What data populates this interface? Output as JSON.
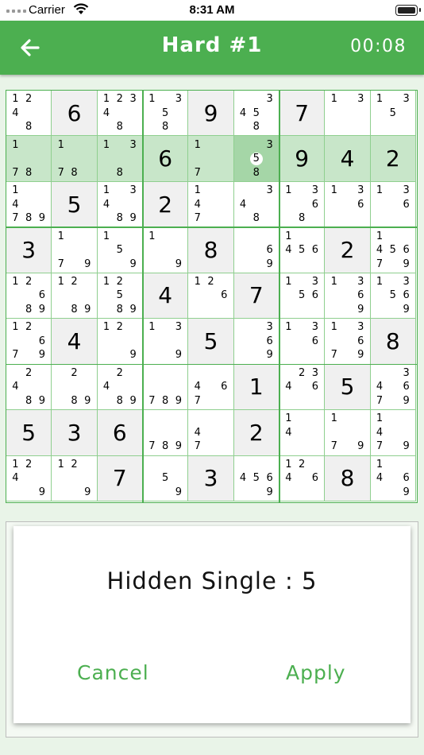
{
  "status": {
    "carrier": "Carrier",
    "time": "8:31 AM"
  },
  "header": {
    "title": "Hard #1",
    "timer": "00:08",
    "back_icon": "arrow-left-icon"
  },
  "colors": {
    "accent": "#4caf50",
    "given_bg": "#f0f0f0",
    "row_highlight": "#c8e6c9",
    "selected": "#a5d6a7"
  },
  "board": {
    "selected": [
      1,
      5
    ],
    "highlighted_row": 1,
    "hint_note": "5",
    "cells": [
      [
        {
          "notes": [
            1,
            2,
            4,
            8
          ]
        },
        {
          "value": 6,
          "given": true
        },
        {
          "notes": [
            1,
            2,
            3,
            4,
            8
          ]
        },
        {
          "notes": [
            1,
            3,
            5,
            8
          ]
        },
        {
          "value": 9,
          "given": true
        },
        {
          "notes": [
            3,
            4,
            5,
            8
          ]
        },
        {
          "value": 7,
          "given": true
        },
        {
          "notes": [
            1,
            3
          ]
        },
        {
          "notes": [
            1,
            3,
            5
          ]
        }
      ],
      [
        {
          "notes": [
            1,
            7,
            8
          ]
        },
        {
          "notes": [
            1,
            7,
            8
          ]
        },
        {
          "notes": [
            1,
            3,
            8
          ]
        },
        {
          "value": 6,
          "given": true
        },
        {
          "notes": [
            1,
            7
          ]
        },
        {
          "notes": [
            3,
            5,
            8
          ]
        },
        {
          "value": 9,
          "given": true
        },
        {
          "value": 4,
          "given": true
        },
        {
          "value": 2,
          "given": true
        }
      ],
      [
        {
          "notes": [
            1,
            4,
            7,
            8,
            9
          ]
        },
        {
          "value": 5,
          "given": true
        },
        {
          "notes": [
            1,
            3,
            4,
            8,
            9
          ]
        },
        {
          "value": 2,
          "given": true
        },
        {
          "notes": [
            1,
            4,
            7
          ]
        },
        {
          "notes": [
            3,
            4,
            8
          ]
        },
        {
          "notes": [
            1,
            3,
            6,
            8
          ]
        },
        {
          "notes": [
            1,
            3,
            6
          ]
        },
        {
          "notes": [
            1,
            3,
            6
          ]
        }
      ],
      [
        {
          "value": 3,
          "given": true
        },
        {
          "notes": [
            1,
            7,
            9
          ]
        },
        {
          "notes": [
            1,
            5,
            9
          ]
        },
        {
          "notes": [
            1,
            9
          ]
        },
        {
          "value": 8,
          "given": true
        },
        {
          "notes": [
            6,
            9
          ]
        },
        {
          "notes": [
            1,
            4,
            5,
            6
          ]
        },
        {
          "value": 2,
          "given": true
        },
        {
          "notes": [
            1,
            4,
            5,
            6,
            7,
            9
          ]
        }
      ],
      [
        {
          "notes": [
            1,
            2,
            6,
            8,
            9
          ]
        },
        {
          "notes": [
            1,
            2,
            8,
            9
          ]
        },
        {
          "notes": [
            1,
            2,
            5,
            8,
            9
          ]
        },
        {
          "value": 4,
          "given": true
        },
        {
          "notes": [
            1,
            2,
            6
          ]
        },
        {
          "value": 7,
          "given": true
        },
        {
          "notes": [
            1,
            3,
            5,
            6
          ]
        },
        {
          "notes": [
            1,
            3,
            6,
            9
          ]
        },
        {
          "notes": [
            1,
            3,
            5,
            6,
            9
          ]
        }
      ],
      [
        {
          "notes": [
            1,
            2,
            6,
            7,
            9
          ]
        },
        {
          "value": 4,
          "given": true
        },
        {
          "notes": [
            1,
            2,
            9
          ]
        },
        {
          "notes": [
            1,
            3,
            9
          ]
        },
        {
          "value": 5,
          "given": true
        },
        {
          "notes": [
            3,
            6,
            9
          ]
        },
        {
          "notes": [
            1,
            3,
            6
          ]
        },
        {
          "notes": [
            1,
            3,
            6,
            7,
            9
          ]
        },
        {
          "value": 8,
          "given": true
        }
      ],
      [
        {
          "notes": [
            2,
            4,
            8,
            9
          ]
        },
        {
          "notes": [
            2,
            8,
            9
          ]
        },
        {
          "notes": [
            2,
            4,
            8,
            9
          ]
        },
        {
          "notes": [
            7,
            8,
            9
          ]
        },
        {
          "notes": [
            4,
            6,
            7
          ]
        },
        {
          "value": 1,
          "given": true
        },
        {
          "notes": [
            2,
            3,
            4,
            6
          ]
        },
        {
          "value": 5,
          "given": true
        },
        {
          "notes": [
            3,
            4,
            6,
            7,
            9
          ]
        }
      ],
      [
        {
          "value": 5,
          "given": true
        },
        {
          "value": 3,
          "given": true
        },
        {
          "value": 6,
          "given": true
        },
        {
          "notes": [
            7,
            8,
            9
          ]
        },
        {
          "notes": [
            4,
            7
          ]
        },
        {
          "value": 2,
          "given": true
        },
        {
          "notes": [
            1,
            4
          ]
        },
        {
          "notes": [
            1,
            7,
            9
          ]
        },
        {
          "notes": [
            1,
            4,
            7,
            9
          ]
        }
      ],
      [
        {
          "notes": [
            1,
            2,
            4,
            9
          ]
        },
        {
          "notes": [
            1,
            2,
            9
          ]
        },
        {
          "value": 7,
          "given": true
        },
        {
          "notes": [
            5,
            9
          ]
        },
        {
          "value": 3,
          "given": true
        },
        {
          "notes": [
            4,
            5,
            6,
            9
          ]
        },
        {
          "notes": [
            1,
            2,
            4,
            6
          ]
        },
        {
          "value": 8,
          "given": true
        },
        {
          "notes": [
            1,
            4,
            6,
            9
          ]
        }
      ]
    ]
  },
  "dialog": {
    "message": "Hidden Single : 5",
    "cancel_label": "Cancel",
    "apply_label": "Apply"
  }
}
